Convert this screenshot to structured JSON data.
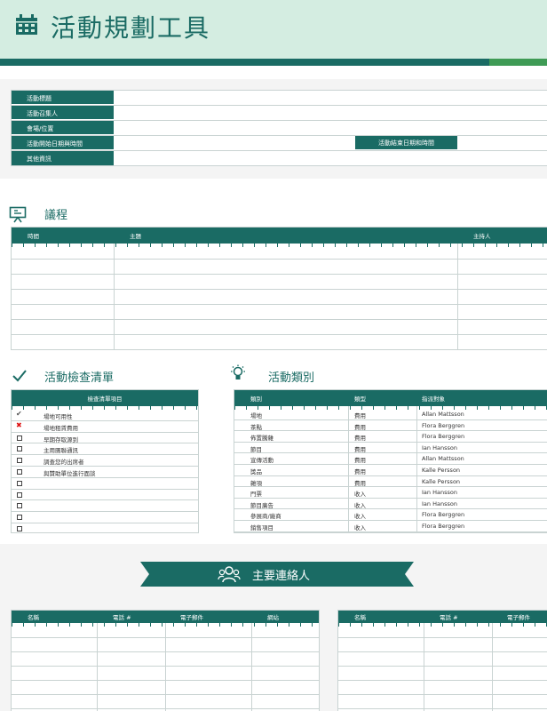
{
  "title": "活動規劃工具",
  "colors": {
    "accent": "#1a6b64",
    "accent_green": "#3f9b55",
    "header_bg": "#d4ede1"
  },
  "event_info": {
    "fields": [
      "活動標題",
      "活動召集人",
      "會場/位置",
      "活動開始日期與時間",
      "其他資訊"
    ],
    "end_label": "活動結束日期和時間"
  },
  "agenda": {
    "title": "議程",
    "icon": "presentation-icon",
    "columns": [
      "時間",
      "主題",
      "主持人"
    ]
  },
  "checklist": {
    "title": "活動檢查清單",
    "icon": "checkmark-icon",
    "column": "檢查清單項目",
    "items": [
      {
        "status": "done",
        "text": "場地可用性"
      },
      {
        "status": "failed",
        "text": "場地租賃費用"
      },
      {
        "status": "open",
        "text": "早期存取源到"
      },
      {
        "status": "open",
        "text": "主用團聯通訊"
      },
      {
        "status": "open",
        "text": "調查您的出席者"
      },
      {
        "status": "open",
        "text": "與贊助單位進行面談"
      },
      {
        "status": "open",
        "text": ""
      },
      {
        "status": "open",
        "text": ""
      },
      {
        "status": "open",
        "text": ""
      },
      {
        "status": "open",
        "text": ""
      },
      {
        "status": "open",
        "text": ""
      }
    ]
  },
  "categories": {
    "title": "活動類別",
    "icon": "lightbulb-icon",
    "columns": [
      "類別",
      "類型",
      "指派對象"
    ],
    "rows": [
      {
        "category": "場地",
        "type": "費用",
        "assignee": "Allan Mattsson"
      },
      {
        "category": "茶點",
        "type": "費用",
        "assignee": "Flora Berggren"
      },
      {
        "category": "佈置騰雜",
        "type": "費用",
        "assignee": "Flora Berggren"
      },
      {
        "category": "節目",
        "type": "費用",
        "assignee": "Ian Hansson"
      },
      {
        "category": "宣傳活動",
        "type": "費用",
        "assignee": "Allan Mattsson"
      },
      {
        "category": "獎品",
        "type": "費用",
        "assignee": "Kalle Persson"
      },
      {
        "category": "雜項",
        "type": "費用",
        "assignee": "Kalle Persson"
      },
      {
        "category": "門票",
        "type": "收入",
        "assignee": "Ian Hansson"
      },
      {
        "category": "節目廣告",
        "type": "收入",
        "assignee": "Ian Hansson"
      },
      {
        "category": "參展商/廠商",
        "type": "收入",
        "assignee": "Flora Berggren"
      },
      {
        "category": "銷售項目",
        "type": "收入",
        "assignee": "Flora Berggren"
      }
    ]
  },
  "contacts": {
    "title": "主要連絡人",
    "icon": "people-icon",
    "columns_left": [
      "名稱",
      "電話 #",
      "電子郵件",
      "網站"
    ],
    "columns_right": [
      "名稱",
      "電話 #",
      "電子郵件"
    ]
  }
}
